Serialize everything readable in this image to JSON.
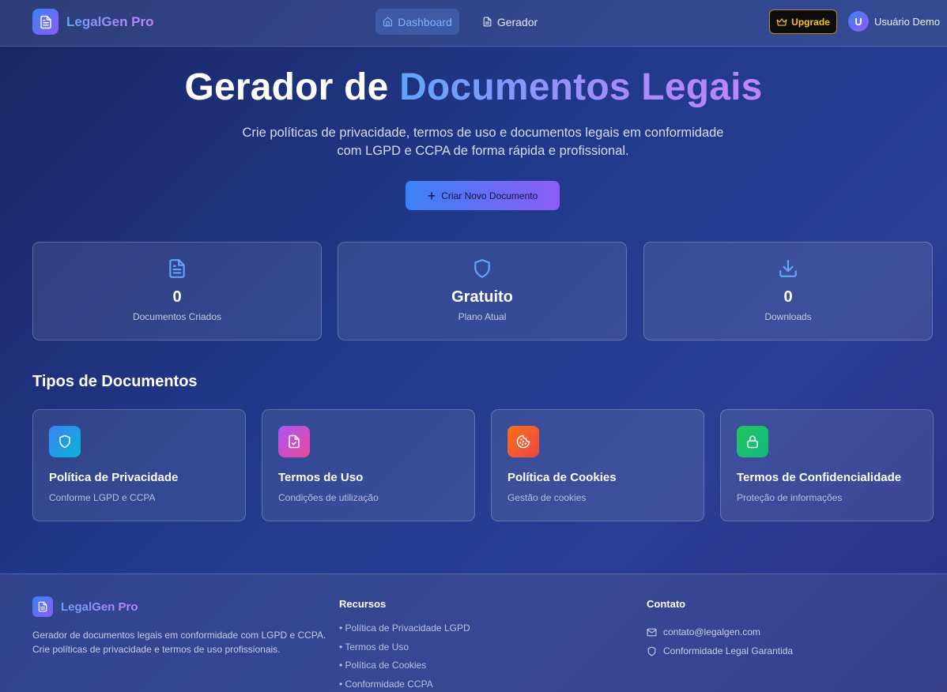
{
  "navbar": {
    "brand": "LegalGen Pro",
    "nav": [
      {
        "label": "Dashboard",
        "icon": "home-icon",
        "active": true
      },
      {
        "label": "Gerador",
        "icon": "document-icon",
        "active": false
      }
    ],
    "upgrade_label": "Upgrade",
    "user_initial": "U",
    "user_name": "Usuário Demo"
  },
  "hero": {
    "title_plain": "Gerador de ",
    "title_gradient": "Documentos Legais",
    "subtitle": "Crie políticas de privacidade, termos de uso e documentos legais em conformidade com LGPD e CCPA de forma rápida e profissional.",
    "cta_label": "Criar Novo Documento"
  },
  "stats": [
    {
      "icon": "document-icon",
      "value": "0",
      "label": "Documentos Criados"
    },
    {
      "icon": "shield-icon",
      "value": "Gratuito",
      "label": "Plano Atual"
    },
    {
      "icon": "download-icon",
      "value": "0",
      "label": "Downloads"
    }
  ],
  "doc_types": {
    "title": "Tipos de Documentos",
    "items": [
      {
        "icon": "shield-icon",
        "title": "Política de Privacidade",
        "desc": "Conforme LGPD e CCPA",
        "color_from": "#3b82f6",
        "color_to": "#06b6d4"
      },
      {
        "icon": "file-check-icon",
        "title": "Termos de Uso",
        "desc": "Condições de utilização",
        "color_from": "#a855f7",
        "color_to": "#ec4899"
      },
      {
        "icon": "cookie-icon",
        "title": "Política de Cookies",
        "desc": "Gestão de cookies",
        "color_from": "#f97316",
        "color_to": "#ef4444"
      },
      {
        "icon": "lock-icon",
        "title": "Termos de Confidencialidade",
        "desc": "Proteção de informações",
        "color_from": "#22c55e",
        "color_to": "#10b981"
      }
    ]
  },
  "footer": {
    "brand": "LegalGen Pro",
    "description": "Gerador de documentos legais em conformidade com LGPD e CCPA. Crie políticas de privacidade e termos de uso profissionais.",
    "resources_title": "Recursos",
    "resources": [
      "• Política de Privacidade LGPD",
      "• Termos de Uso",
      "• Política de Cookies",
      "• Conformidade CCPA"
    ],
    "contact_title": "Contato",
    "contact_email": "contato@legalgen.com",
    "contact_compliance": "Conformidade Legal Garantida"
  }
}
